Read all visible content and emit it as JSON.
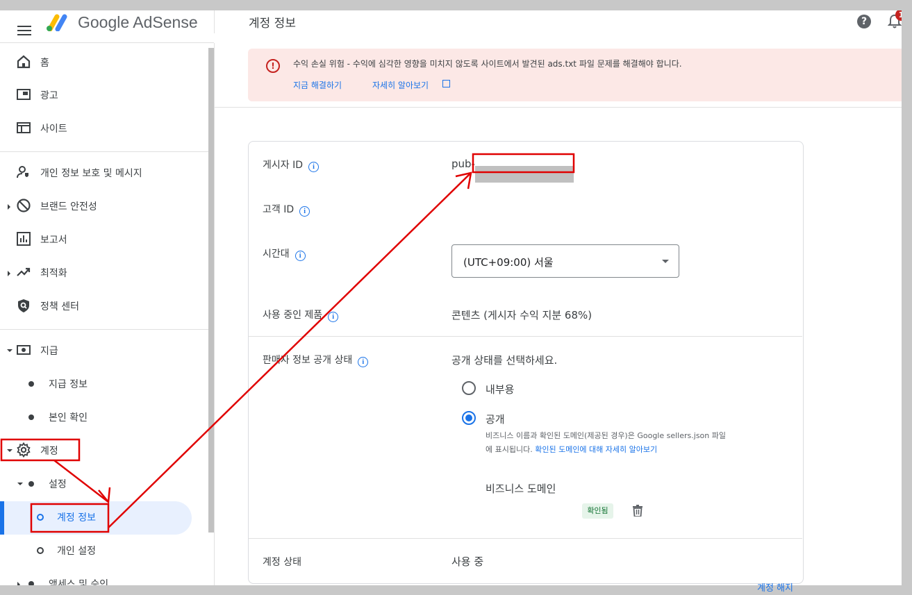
{
  "header": {
    "brand": "Google AdSense",
    "page_title": "계정 정보",
    "help_symbol": "?",
    "notification_count": "1"
  },
  "sidebar": {
    "items": [
      {
        "label": "홈",
        "icon": "home-icon"
      },
      {
        "label": "광고",
        "icon": "ads-icon"
      },
      {
        "label": "사이트",
        "icon": "sites-icon"
      },
      {
        "label": "개인 정보 보호 및 메시지",
        "icon": "privacy-icon"
      },
      {
        "label": "브랜드 안전성",
        "icon": "block-icon"
      },
      {
        "label": "보고서",
        "icon": "reports-icon"
      },
      {
        "label": "최적화",
        "icon": "trending-icon"
      },
      {
        "label": "정책 센터",
        "icon": "shield-icon"
      },
      {
        "label": "지급",
        "icon": "payments-icon"
      },
      {
        "label": "지급 정보"
      },
      {
        "label": "본인 확인"
      },
      {
        "label": "계정",
        "icon": "gear-icon"
      },
      {
        "label": "설정"
      },
      {
        "label": "계정 정보"
      },
      {
        "label": "개인 설정"
      },
      {
        "label": "액세스 및 승인"
      }
    ]
  },
  "alert": {
    "message": "수익 손실 위험 - 수익에 심각한 영향을 미치지 않도록 사이트에서 발견된 ads.txt 파일 문제를 해결해야 합니다.",
    "fix_link": "지금 해결하기",
    "learn_link": "자세히 알아보기",
    "color": "#fce8e6"
  },
  "account": {
    "publisher_id_label": "게시자 ID",
    "publisher_id_value": "pub-",
    "customer_id_label": "고객 ID",
    "timezone_label": "시간대",
    "timezone_value": "(UTC+09:00) 서울",
    "products_label": "사용 중인 제품",
    "products_value": "콘텐츠 (게시자 수익 지분 68%)",
    "seller_label": "판매자 정보 공개 상태",
    "seller_prompt": "공개 상태를 선택하세요.",
    "radio_internal": "내부용",
    "radio_public": "공개",
    "help_text_1": "비즈니스 이름과 확인된 도메인(제공된 경우)은 Google sellers.json 파일",
    "help_text_2": "에 표시됩니다.",
    "help_link": "확인된 도메인에 대해 자세히 알아보기",
    "business_domain_label": "비즈니스 도메인",
    "verified_badge": "확인됨",
    "status_label": "계정 상태",
    "status_value": "사용 중",
    "cancel_link": "계정 해지"
  },
  "colors": {
    "accent": "#1a73e8",
    "error": "#c5221f",
    "annotation": "#e00000"
  }
}
